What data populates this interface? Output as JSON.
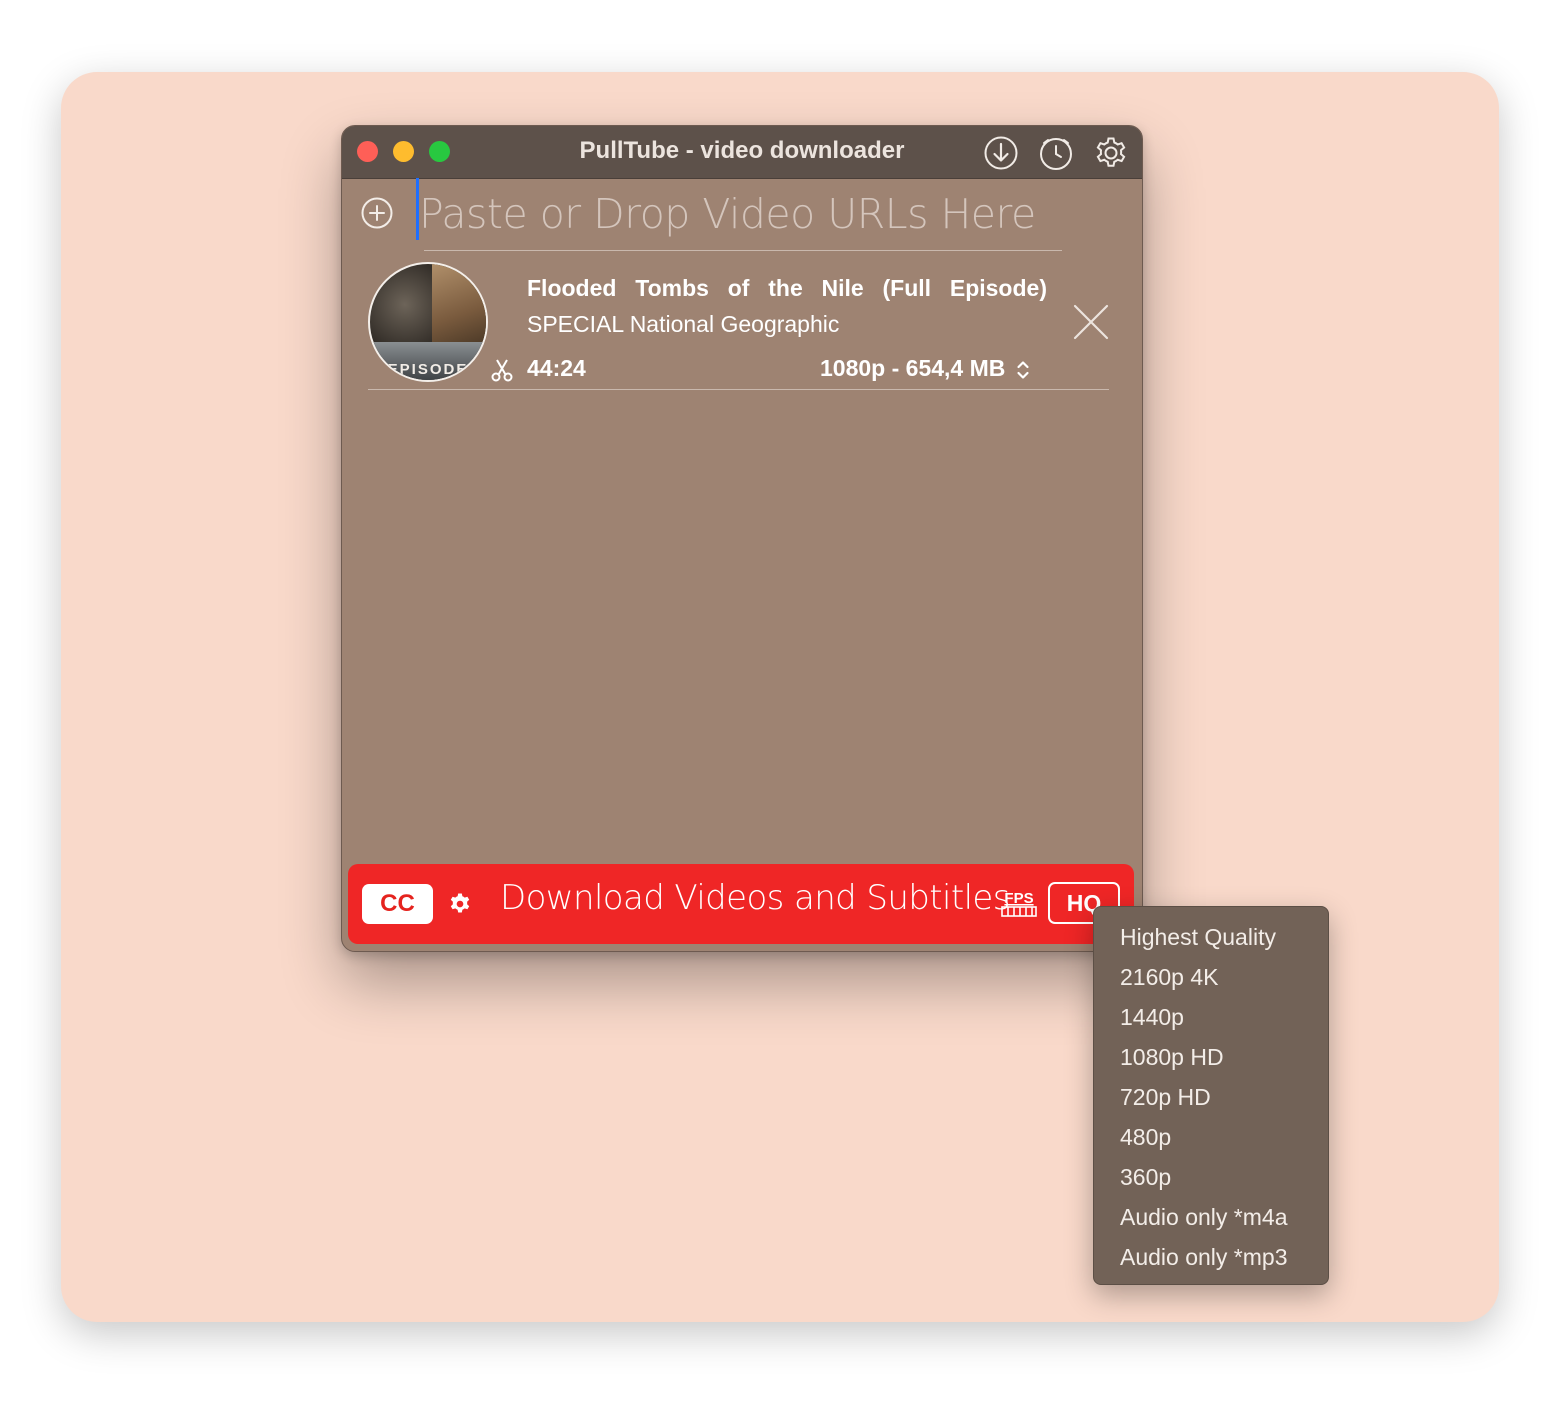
{
  "window": {
    "title": "PullTube - video downloader"
  },
  "toolbar": {
    "downloads_icon": "download-circle-icon",
    "history_icon": "clock-icon",
    "settings_icon": "gear-icon"
  },
  "url_input": {
    "placeholder": "Paste or Drop Video URLs Here",
    "value": ""
  },
  "video": {
    "title": "Flooded Tombs of the Nile (Full Episode)",
    "channel": "SPECIAL  National Geographic",
    "thumbnail_text": "EPISODE",
    "duration": "44:24",
    "format": "1080p - 654,4 MB"
  },
  "footer": {
    "cc_label": "CC",
    "download_label": "Download Videos and Subtitles",
    "fps_label": "FPS",
    "quality_label": "HQ",
    "accent": "#ef2626"
  },
  "quality_menu": {
    "items": [
      "Highest Quality",
      "2160p 4K",
      "1440p",
      "1080p HD",
      "720p HD",
      "480p",
      "360p",
      "Audio only *m4a",
      "Audio only *mp3"
    ]
  },
  "colors": {
    "backdrop": "#f9d9ca",
    "window": "#9e8372",
    "titlebar": "#5d514a",
    "menu": "#726257"
  }
}
